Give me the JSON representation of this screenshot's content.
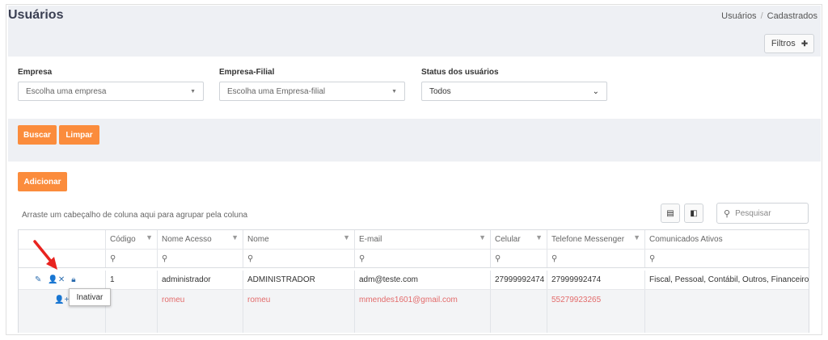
{
  "header": {
    "title": "Usuários",
    "breadcrumb": [
      "Usuários",
      "Cadastrados"
    ],
    "filters_button": "Filtros"
  },
  "filters": {
    "empresa": {
      "label": "Empresa",
      "placeholder": "Escolha uma empresa"
    },
    "empresa_filial": {
      "label": "Empresa-Filial",
      "placeholder": "Escolha uma Empresa-filial"
    },
    "status": {
      "label": "Status dos usuários",
      "value": "Todos"
    }
  },
  "actions": {
    "search": "Buscar",
    "clear": "Limpar",
    "add": "Adicionar"
  },
  "grid": {
    "group_hint": "Arraste um cabeçalho de coluna aqui para agrupar pela coluna",
    "search_placeholder": "Pesquisar",
    "columns": [
      "Código",
      "Nome Acesso",
      "Nome",
      "E-mail",
      "Celular",
      "Telefone Messenger",
      "Comunicados Ativos"
    ],
    "rows": [
      {
        "codigo": "1",
        "nome_acesso": "administrador",
        "nome": "ADMINISTRADOR",
        "email": "adm@teste.com",
        "celular": "27999992474",
        "telefone": "27999992474",
        "comunicados": "Fiscal, Pessoal, Contábil, Outros, Financeiro, S"
      },
      {
        "codigo": "",
        "nome_acesso": "romeu",
        "nome": "romeu",
        "email": "mmendes1601@gmail.com",
        "celular": "",
        "telefone": "55279923265",
        "comunicados": ""
      }
    ],
    "tooltip": "Inativar"
  },
  "colors": {
    "accent": "#fb8c3c",
    "inactive_text": "#e36b6b",
    "icon_blue": "#2f6fb0",
    "arrow_red": "#e8231f"
  }
}
